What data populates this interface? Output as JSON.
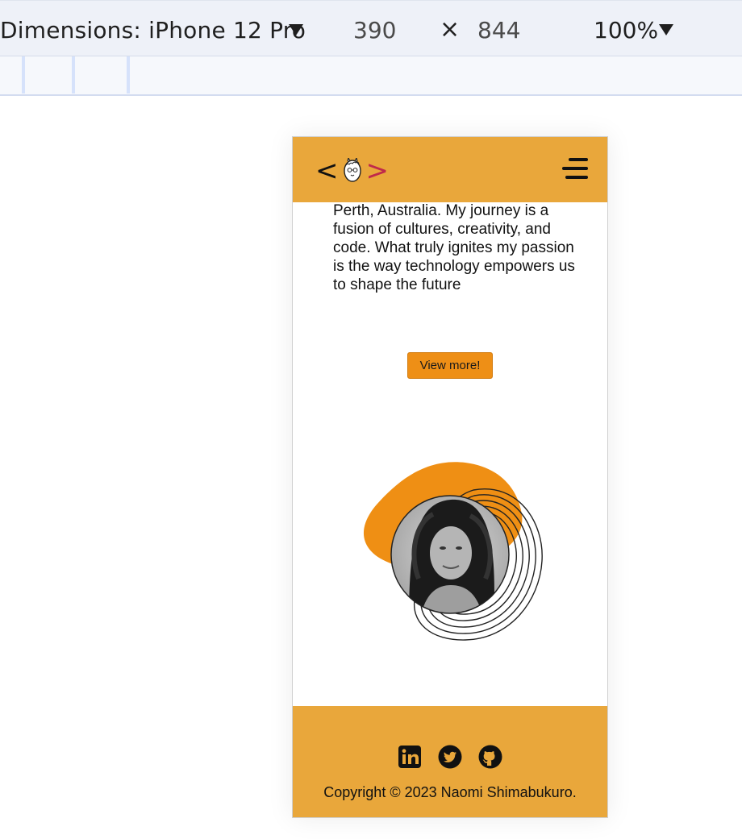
{
  "devtools": {
    "dimensions_label": "Dimensions: iPhone 12 Pro",
    "width": "390",
    "times": "×",
    "height": "844",
    "zoom": "100%"
  },
  "site": {
    "header": {
      "logo_left": "<",
      "logo_right": ">",
      "logo_icon": "llama-icon",
      "menu_icon": "hamburger-menu-icon"
    },
    "intro_text": "Perth, Australia. My journey is a fusion of cultures, creativity, and code. What truly ignites my passion is the way technology empowers us to shape the future",
    "view_more_label": "View more!",
    "portrait": {
      "blob_color": "#ef8f14",
      "rings_color": "#222222"
    },
    "footer": {
      "socials": [
        {
          "name": "linkedin-icon"
        },
        {
          "name": "twitter-icon"
        },
        {
          "name": "github-icon"
        }
      ],
      "copyright": "Copyright © 2023 Naomi Shimabukuro."
    },
    "colors": {
      "header_bg": "#e9a73b",
      "button_bg": "#ee8f16",
      "logo_accent": "#c0294a"
    }
  }
}
